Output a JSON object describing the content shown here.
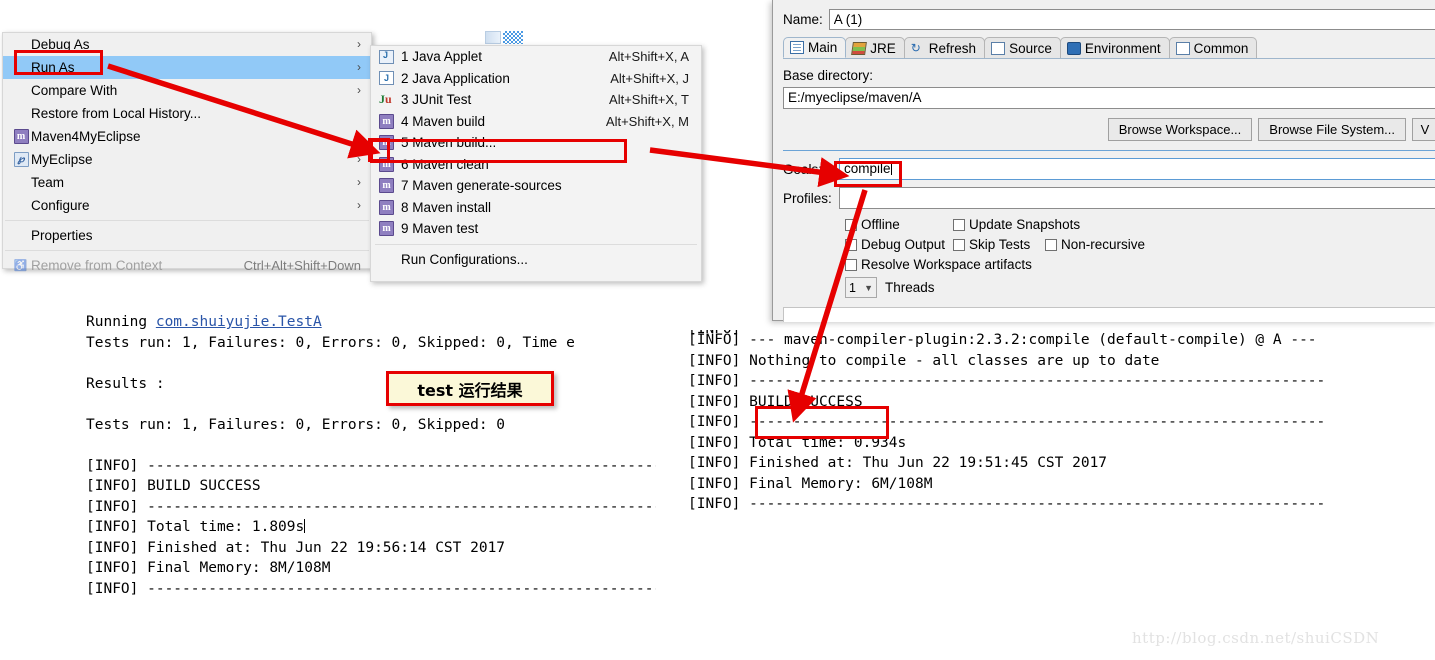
{
  "context_menu": {
    "items": [
      {
        "label": "Debug As",
        "icon": "",
        "arrow": true,
        "selected": false,
        "dim": false,
        "accel": ""
      },
      {
        "label": "Run As",
        "icon": "",
        "arrow": true,
        "selected": true,
        "dim": false,
        "accel": ""
      },
      {
        "label": "Compare With",
        "icon": "",
        "arrow": true,
        "selected": false,
        "dim": false,
        "accel": ""
      },
      {
        "label": "Restore from Local History...",
        "icon": "",
        "arrow": false,
        "selected": false,
        "dim": false,
        "accel": ""
      },
      {
        "label": "Maven4MyEclipse",
        "icon": "maven-icon",
        "arrow": true,
        "selected": false,
        "dim": false,
        "accel": ""
      },
      {
        "label": "MyEclipse",
        "icon": "myeclipse-icon",
        "arrow": true,
        "selected": false,
        "dim": false,
        "accel": ""
      },
      {
        "label": "Team",
        "icon": "",
        "arrow": true,
        "selected": false,
        "dim": false,
        "accel": ""
      },
      {
        "label": "Configure",
        "icon": "",
        "arrow": true,
        "selected": false,
        "dim": false,
        "accel": ""
      },
      {
        "label": "Properties",
        "icon": "",
        "arrow": false,
        "selected": false,
        "dim": false,
        "accel": ""
      },
      {
        "label": "Remove from Context",
        "icon": "remove-icon",
        "arrow": false,
        "selected": false,
        "dim": true,
        "accel": "Ctrl+Alt+Shift+Down"
      }
    ]
  },
  "run_as_submenu": {
    "items": [
      {
        "label": "1 Java Applet",
        "icon": "java-applet-icon",
        "accel": "Alt+Shift+X, A"
      },
      {
        "label": "2 Java Application",
        "icon": "java-app-icon",
        "accel": "Alt+Shift+X, J"
      },
      {
        "label": "3 JUnit Test",
        "icon": "junit-icon",
        "accel": "Alt+Shift+X, T"
      },
      {
        "label": "4 Maven build",
        "icon": "maven-icon",
        "accel": "Alt+Shift+X, M"
      },
      {
        "label": "5 Maven build...",
        "icon": "maven-icon",
        "accel": ""
      },
      {
        "label": "6 Maven clean",
        "icon": "maven-icon",
        "accel": ""
      },
      {
        "label": "7 Maven generate-sources",
        "icon": "maven-icon",
        "accel": ""
      },
      {
        "label": "8 Maven install",
        "icon": "maven-icon",
        "accel": ""
      },
      {
        "label": "9 Maven test",
        "icon": "maven-icon",
        "accel": ""
      }
    ],
    "run_configurations": "Run Configurations..."
  },
  "launch_dialog": {
    "name_label": "Name:",
    "name_value": "A (1)",
    "tabs": [
      {
        "label": "Main",
        "icon": "main-tab-icon",
        "active": true
      },
      {
        "label": "JRE",
        "icon": "jre-tab-icon",
        "active": false
      },
      {
        "label": "Refresh",
        "icon": "refresh-tab-icon",
        "active": false
      },
      {
        "label": "Source",
        "icon": "source-tab-icon",
        "active": false
      },
      {
        "label": "Environment",
        "icon": "environment-tab-icon",
        "active": false
      },
      {
        "label": "Common",
        "icon": "common-tab-icon",
        "active": false
      }
    ],
    "base_directory_label": "Base directory:",
    "base_directory_value": "E:/myeclipse/maven/A",
    "buttons": [
      {
        "label": "Browse Workspace..."
      },
      {
        "label": "Browse File System..."
      },
      {
        "label": "V"
      }
    ],
    "goals_label": "Goals:",
    "goals_value": "compile",
    "profiles_label": "Profiles:",
    "profiles_value": "",
    "checkboxes": [
      {
        "label": "Offline",
        "checked": false
      },
      {
        "label": "Update Snapshots",
        "checked": false
      },
      {
        "label": "Debug Output",
        "checked": false
      },
      {
        "label": "Skip Tests",
        "checked": false
      },
      {
        "label": "Non-recursive",
        "checked": false
      },
      {
        "label": "Resolve Workspace artifacts",
        "checked": false
      }
    ],
    "threads_value": "1",
    "threads_label": "Threads"
  },
  "left_console": {
    "line_running_prefix": "Running ",
    "line_running_link": "com.shuiyujie.TestA",
    "lines": [
      "Tests run: 1, Failures: 0, Errors: 0, Skipped: 0, Time e",
      "",
      "Results :",
      "",
      "Tests run: 1, Failures: 0, Errors: 0, Skipped: 0",
      "",
      "[INFO] ------------------------------------------------------------",
      "[INFO] BUILD SUCCESS",
      "[INFO] ------------------------------------------------------------",
      "[INFO] Total time: 1.809s",
      "[INFO] Finished at: Thu Jun 22 19:56:14 CST 2017",
      "[INFO] Final Memory: 8M/108M",
      "[INFO] ------------------------------------------------------------"
    ]
  },
  "right_console": {
    "remnant": "[INFO]",
    "lines": [
      "[INFO] --- maven-compiler-plugin:2.3.2:compile (default-compile) @ A ---",
      "[INFO] Nothing to compile - all classes are up to date",
      "[INFO] ------------------------------------------------------------------",
      "[INFO] BUILD SUCCESS",
      "[INFO] ------------------------------------------------------------------",
      "[INFO] Total time: 0.934s",
      "[INFO] Finished at: Thu Jun 22 19:51:45 CST 2017",
      "[INFO] Final Memory: 6M/108M",
      "[INFO] ------------------------------------------------------------------"
    ]
  },
  "annotations": {
    "callout_text": "test 运行结果",
    "highlight_color": "#e60000",
    "callout_bg": "#fbf8d8"
  },
  "watermark": "http://blog.csdn.net/shuiCSDN"
}
